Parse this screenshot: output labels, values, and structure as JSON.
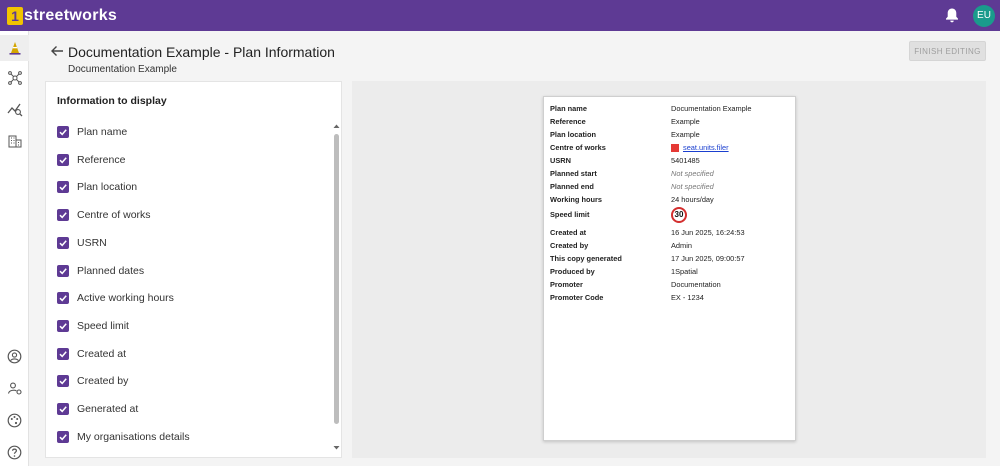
{
  "app": {
    "logo_mark": "1",
    "logo_text": "streetworks",
    "user_initials": "EU"
  },
  "header": {
    "title": "Documentation Example - Plan Information",
    "subtitle": "Documentation Example",
    "finish_label": "FINISH EDITING"
  },
  "panel": {
    "title": "Information to display",
    "options": [
      {
        "label": "Plan name",
        "checked": true
      },
      {
        "label": "Reference",
        "checked": true
      },
      {
        "label": "Plan location",
        "checked": true
      },
      {
        "label": "Centre of works",
        "checked": true
      },
      {
        "label": "USRN",
        "checked": true
      },
      {
        "label": "Planned dates",
        "checked": true
      },
      {
        "label": "Active working hours",
        "checked": true
      },
      {
        "label": "Speed limit",
        "checked": true
      },
      {
        "label": "Created at",
        "checked": true
      },
      {
        "label": "Created by",
        "checked": true
      },
      {
        "label": "Generated at",
        "checked": true
      },
      {
        "label": "My organisations details",
        "checked": true
      }
    ]
  },
  "doc": {
    "rows": [
      {
        "key": "Plan name",
        "value": "Documentation Example"
      },
      {
        "key": "Reference",
        "value": "Example"
      },
      {
        "key": "Plan location",
        "value": "Example"
      },
      {
        "key": "Centre of works",
        "value": "seat.units.filer"
      },
      {
        "key": "USRN",
        "value": "5401485"
      },
      {
        "key": "Planned start",
        "value": "Not specified"
      },
      {
        "key": "Planned end",
        "value": "Not specified"
      },
      {
        "key": "Working hours",
        "value": "24 hours/day"
      },
      {
        "key": "Speed limit",
        "value": "30"
      },
      {
        "key": "Created at",
        "value": "16 Jun 2025, 16:24:53"
      },
      {
        "key": "Created by",
        "value": "Admin"
      },
      {
        "key": "This copy generated",
        "value": "17 Jun 2025, 09:00:57"
      },
      {
        "key": "Produced by",
        "value": "1Spatial"
      },
      {
        "key": "Promoter",
        "value": "Documentation"
      },
      {
        "key": "Promoter Code",
        "value": "EX - 1234"
      }
    ]
  },
  "colors": {
    "brand": "#5e3a94",
    "accent": "#f2c400",
    "avatar": "#1a9b8c"
  },
  "nav_icons": [
    "cone-icon",
    "network-icon",
    "analytics-icon",
    "building-icon",
    "account-icon",
    "user-settings-icon",
    "palette-icon",
    "help-icon"
  ]
}
